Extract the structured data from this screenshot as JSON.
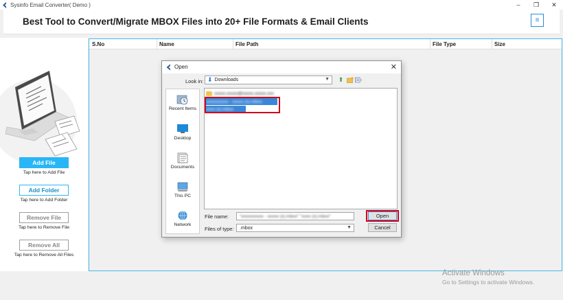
{
  "window": {
    "title": "Sysinfo Email Converter( Demo )",
    "controls": [
      "–",
      "❐",
      "✕"
    ]
  },
  "header": {
    "headline": "Best Tool to Convert/Migrate MBOX Files into 20+ File Formats & Email Clients",
    "menu_icon": "≡"
  },
  "actions": [
    {
      "label": "Add File",
      "hint": "Tap here to Add File",
      "style": "primary"
    },
    {
      "label": "Add Folder",
      "hint": "Tap here to Add Folder",
      "style": "outline"
    },
    {
      "label": "Remove File",
      "hint": "Tap here to Remove File",
      "style": "gray"
    },
    {
      "label": "Remove All",
      "hint": "Tap here to Remove All Files",
      "style": "gray"
    }
  ],
  "grid": {
    "columns": [
      "S.No",
      "Name",
      "File Path",
      "File Type",
      "Size"
    ]
  },
  "dialog": {
    "title": "Open",
    "close": "✕",
    "look_in_label": "Look in:",
    "look_in_value": "Downloads",
    "places": [
      "Recent Items",
      "Desktop",
      "Documents",
      "This PC",
      "Network"
    ],
    "files": [
      {
        "name": "xxxxx.xxxxx@xxxxx.xxxxx.xxx",
        "type": "folder",
        "selected": false
      },
      {
        "name": "xxxxxxxxxx - xxxxx (x).mbox",
        "type": "file",
        "selected": true
      },
      {
        "name": "xxxx (x).mbox",
        "type": "file",
        "selected": true
      }
    ],
    "file_name_label": "File name:",
    "file_name_value": "\"xxxxxxxxxx - xxxxx (x).mbox\" \"xxxx (x).mbox\"",
    "file_type_label": "Files of type:",
    "file_type_value": ".mbox",
    "open_label": "Open",
    "cancel_label": "Cancel"
  },
  "watermark": {
    "title": "Activate Windows",
    "subtitle": "Go to Settings to activate Windows."
  },
  "colors": {
    "accent": "#29b6f6",
    "highlight": "#d0021b",
    "selection": "#3b86d8"
  }
}
